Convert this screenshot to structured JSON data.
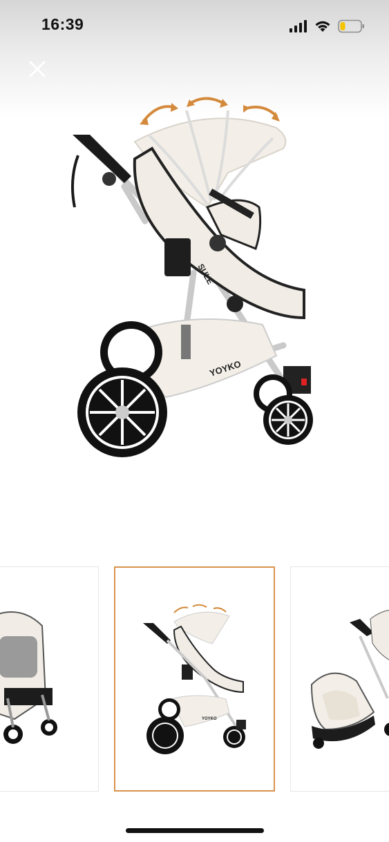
{
  "status_bar": {
    "time": "16:39",
    "battery_level": 0.25,
    "battery_color": "#f5c400",
    "icons": [
      "cellular-signal-icon",
      "wifi-icon",
      "battery-icon"
    ]
  },
  "viewer": {
    "close_icon": "close-icon",
    "hero_image": {
      "brand_text": "YOYKO",
      "side_text": "SULE"
    },
    "thumbnails": [
      {
        "name": "stroller-front-view",
        "selected": false
      },
      {
        "name": "stroller-side-view",
        "selected": true,
        "brand_text": "YOYKO"
      },
      {
        "name": "stroller-with-car-seat",
        "selected": false
      }
    ],
    "accent_color": "#d9924d"
  }
}
